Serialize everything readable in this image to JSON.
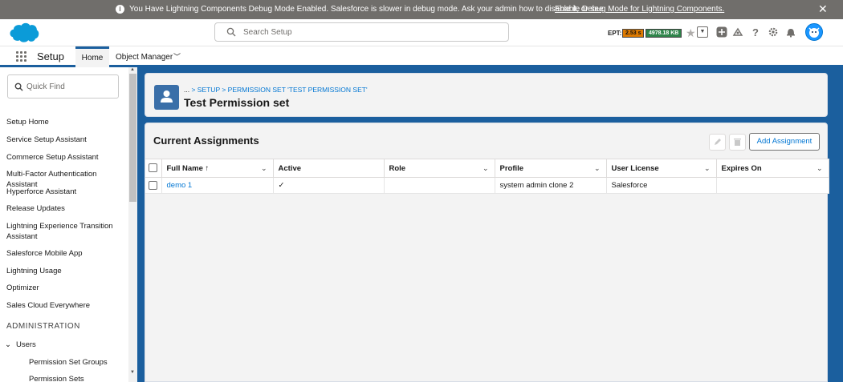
{
  "banner": {
    "message": "You Have Lightning Components Debug Mode Enabled. Salesforce is slower in debug mode. Ask your admin how to disable it, or see",
    "link": "Enable Debug Mode for Lightning Components.",
    "close": "✕"
  },
  "header": {
    "search_placeholder": "Search Setup",
    "ept_label": "EPT:",
    "ept_value": "2.53 s",
    "size_value": "4978.18 KB"
  },
  "nav": {
    "app_name": "Setup",
    "tabs": [
      {
        "label": "Home"
      },
      {
        "label": "Object Manager"
      }
    ]
  },
  "sidebar": {
    "quick_find_placeholder": "Quick Find",
    "items": [
      "Setup Home",
      "Service Setup Assistant",
      "Commerce Setup Assistant",
      "Multi-Factor Authentication Assistant",
      "Hyperforce Assistant",
      "Release Updates",
      "Lightning Experience Transition Assistant",
      "Salesforce Mobile App",
      "Lightning Usage",
      "Optimizer",
      "Sales Cloud Everywhere"
    ],
    "section": "ADMINISTRATION",
    "users": "Users",
    "sub_items": [
      "Permission Set Groups",
      "Permission Sets"
    ]
  },
  "page_header": {
    "breadcrumb_dots": "...",
    "breadcrumb": " > SETUP > PERMISSION SET 'TEST PERMISSION SET'",
    "title": "Test Permission set"
  },
  "assignments": {
    "title": "Current Assignments",
    "add_label": "Add Assignment",
    "columns": [
      "Full Name ↑",
      "Active",
      "Role",
      "Profile",
      "User License",
      "Expires On"
    ],
    "rows": [
      {
        "full_name": "demo 1",
        "active": "✓",
        "role": "",
        "profile": "system admin clone 2",
        "license": "Salesforce",
        "expires": ""
      }
    ]
  },
  "colors": {
    "brand_blue": "#1b5f9e",
    "link_blue": "#0176d3",
    "banner_gray": "#706e6b"
  }
}
